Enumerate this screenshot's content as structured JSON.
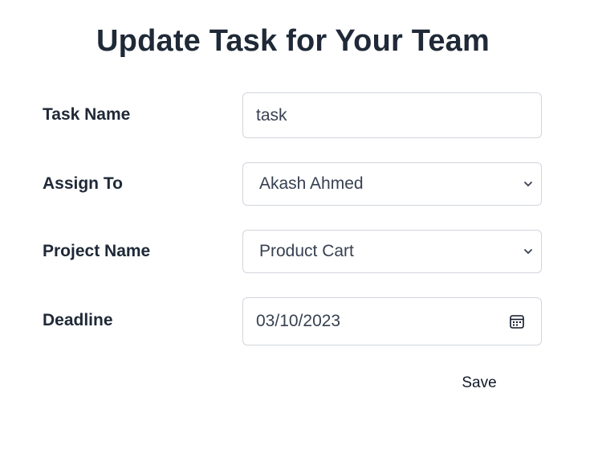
{
  "title": "Update Task for Your Team",
  "form": {
    "task_name": {
      "label": "Task Name",
      "value": "task"
    },
    "assign_to": {
      "label": "Assign To",
      "value": "Akash Ahmed"
    },
    "project_name": {
      "label": "Project Name",
      "value": "Product Cart"
    },
    "deadline": {
      "label": "Deadline",
      "value": "03/10/2023"
    }
  },
  "actions": {
    "save_label": "Save"
  },
  "icons": {
    "select_arrow": "chevron-down-icon",
    "date_picker": "calendar-icon"
  }
}
